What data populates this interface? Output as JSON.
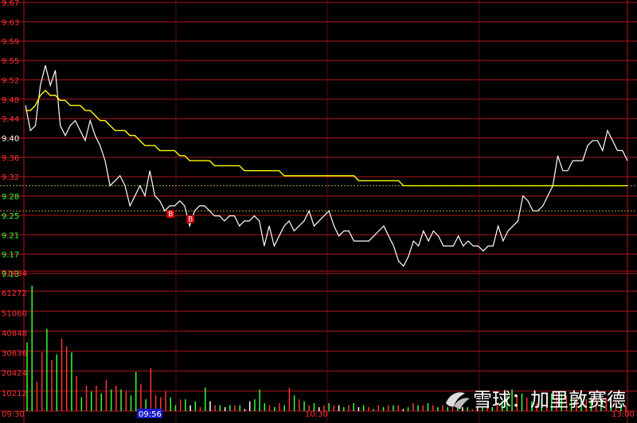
{
  "chart_data": {
    "type": "line",
    "price_axis": {
      "ticks": [
        "9.67",
        "9.63",
        "9.59",
        "9.55",
        "9.52",
        "9.48",
        "9.44",
        "9.40",
        "9.36",
        "9.32",
        "9.28",
        "9.25",
        "9.21",
        "9.17",
        "9.13"
      ],
      "ylim": [
        9.13,
        9.67
      ],
      "reference_price": 9.3,
      "reference_price_alt": 9.25
    },
    "volume_axis": {
      "ticks": [
        "71484",
        "61272",
        "51060",
        "40848",
        "30636",
        "20424",
        "10212"
      ],
      "ylim": [
        0,
        71484
      ]
    },
    "time_axis": {
      "labels": [
        "09:30",
        "09:56",
        "10:30",
        "13:00"
      ],
      "highlighted": "09:56"
    },
    "series": [
      {
        "role": "price",
        "color": "#ffffff",
        "values": [
          9.46,
          9.41,
          9.42,
          9.5,
          9.54,
          9.5,
          9.53,
          9.42,
          9.4,
          9.42,
          9.43,
          9.41,
          9.39,
          9.43,
          9.4,
          9.38,
          9.35,
          9.3,
          9.31,
          9.32,
          9.3,
          9.26,
          9.28,
          9.3,
          9.28,
          9.33,
          9.28,
          9.27,
          9.25,
          9.26,
          9.26,
          9.27,
          9.26,
          9.22,
          9.25,
          9.26,
          9.26,
          9.25,
          9.24,
          9.24,
          9.23,
          9.24,
          9.24,
          9.22,
          9.23,
          9.23,
          9.24,
          9.23,
          9.18,
          9.22,
          9.18,
          9.2,
          9.22,
          9.23,
          9.21,
          9.22,
          9.23,
          9.25,
          9.22,
          9.23,
          9.24,
          9.25,
          9.22,
          9.2,
          9.21,
          9.21,
          9.19,
          9.19,
          9.19,
          9.19,
          9.2,
          9.21,
          9.22,
          9.2,
          9.18,
          9.15,
          9.14,
          9.16,
          9.19,
          9.18,
          9.21,
          9.19,
          9.21,
          9.2,
          9.18,
          9.18,
          9.18,
          9.2,
          9.18,
          9.19,
          9.18,
          9.18,
          9.17,
          9.18,
          9.18,
          9.22,
          9.19,
          9.21,
          9.22,
          9.23,
          9.28,
          9.27,
          9.25,
          9.25,
          9.26,
          9.28,
          9.3,
          9.36,
          9.33,
          9.33,
          9.35,
          9.35,
          9.35,
          9.38,
          9.39,
          9.39,
          9.37,
          9.41,
          9.39,
          9.37,
          9.37,
          9.35
        ]
      },
      {
        "role": "average_price",
        "color": "#ffff00",
        "values": [
          9.45,
          9.45,
          9.46,
          9.48,
          9.49,
          9.48,
          9.48,
          9.47,
          9.47,
          9.46,
          9.46,
          9.46,
          9.45,
          9.45,
          9.44,
          9.43,
          9.43,
          9.42,
          9.41,
          9.41,
          9.41,
          9.4,
          9.4,
          9.39,
          9.38,
          9.38,
          9.38,
          9.37,
          9.37,
          9.37,
          9.37,
          9.36,
          9.36,
          9.35,
          9.35,
          9.35,
          9.35,
          9.35,
          9.34,
          9.34,
          9.34,
          9.34,
          9.34,
          9.34,
          9.33,
          9.33,
          9.33,
          9.33,
          9.33,
          9.33,
          9.33,
          9.33,
          9.32,
          9.32,
          9.32,
          9.32,
          9.32,
          9.32,
          9.32,
          9.32,
          9.32,
          9.32,
          9.32,
          9.32,
          9.32,
          9.32,
          9.32,
          9.31,
          9.31,
          9.31,
          9.31,
          9.31,
          9.31,
          9.31,
          9.31,
          9.31,
          9.3,
          9.3,
          9.3,
          9.3,
          9.3,
          9.3,
          9.3,
          9.3,
          9.3,
          9.3,
          9.3,
          9.3,
          9.3,
          9.3,
          9.3,
          9.3,
          9.3,
          9.3,
          9.3,
          9.3,
          9.3,
          9.3,
          9.3,
          9.3,
          9.3,
          9.3,
          9.3,
          9.3,
          9.3,
          9.3,
          9.3,
          9.3,
          9.3,
          9.3,
          9.3,
          9.3,
          9.3,
          9.3,
          9.3,
          9.3,
          9.3,
          9.3,
          9.3,
          9.3,
          9.3,
          9.3
        ]
      }
    ],
    "markers": [
      {
        "label": "B",
        "index": 29,
        "price": 9.25
      },
      {
        "label": "B",
        "index": 33,
        "price": 9.24
      }
    ],
    "volume": {
      "values": [
        35000,
        64000,
        15000,
        30000,
        42000,
        26000,
        29000,
        37000,
        33000,
        30000,
        18000,
        7000,
        13000,
        10000,
        13000,
        9000,
        16000,
        11000,
        13000,
        11000,
        10000,
        8000,
        20000,
        14000,
        6000,
        22000,
        8000,
        7000,
        10000,
        7000,
        3000,
        6000,
        6000,
        3000,
        5000,
        2000,
        12000,
        5000,
        3000,
        3000,
        2000,
        3000,
        3000,
        3000,
        1000,
        5000,
        6000,
        11000,
        4000,
        3000,
        2000,
        4000,
        3000,
        12000,
        8000,
        6000,
        5000,
        3000,
        4000,
        2000,
        3000,
        4000,
        3000,
        3000,
        2000,
        3000,
        4000,
        2000,
        3000,
        2000,
        1000,
        3000,
        2000,
        3000,
        3000,
        3000,
        1000,
        2000,
        4000,
        3000,
        3000,
        4000,
        3000,
        2000,
        3000,
        2000,
        3000,
        2000,
        2000,
        2000,
        1000,
        2000,
        2000,
        3000,
        2000,
        4000,
        5000,
        8000,
        11000,
        8000,
        9000,
        7000,
        5000,
        4000,
        6000,
        5000,
        9000,
        10000,
        9000,
        8000,
        8000,
        6000,
        7000,
        6000,
        7000,
        7000,
        6000,
        7000,
        4000,
        5000,
        4000,
        3000
      ],
      "colors": [
        "#33ff33",
        "#33ff33",
        "#ff3333",
        "#ff3333",
        "#33ff33",
        "#ff3333",
        "#33ff33",
        "#ff3333",
        "#ff3333",
        "#33ff33",
        "#ff3333",
        "#33ff33",
        "#ff3333",
        "#33ff33",
        "#ff3333",
        "#33ff33",
        "#ff3333",
        "#33ff33",
        "#ff3333",
        "#33ff33",
        "#ff3333",
        "#33ff33",
        "#33ff33",
        "#ff3333",
        "#33ff33",
        "#ff3333",
        "#ff3333",
        "#ff3333",
        "#ff3333",
        "#33ff33",
        "#33ff33",
        "#ff3333",
        "#33ff33",
        "#ffffff",
        "#33ff33",
        "#ff3333",
        "#33ff33",
        "#ffffff",
        "#ff3333",
        "#33ff33",
        "#ffffff",
        "#33ff33",
        "#ff3333",
        "#33ff33",
        "#ffffff",
        "#ffffff",
        "#33ff33",
        "#33ff33",
        "#33ff33",
        "#ff3333",
        "#33ff33",
        "#ff3333",
        "#33ff33",
        "#ff3333",
        "#33ff33",
        "#ff3333",
        "#33ff33",
        "#ff3333",
        "#33ff33",
        "#ffffff",
        "#ff3333",
        "#33ff33",
        "#ff3333",
        "#ffffff",
        "#33ff33",
        "#ff3333",
        "#33ff33",
        "#ffffff",
        "#33ff33",
        "#ff3333",
        "#33ff33",
        "#ff3333",
        "#33ff33",
        "#ff3333",
        "#33ff33",
        "#ff3333",
        "#ffffff",
        "#33ff33",
        "#ff3333",
        "#33ff33",
        "#ff3333",
        "#33ff33",
        "#ff3333",
        "#33ff33",
        "#ff3333",
        "#33ff33",
        "#ff3333",
        "#33ff33",
        "#ffffff",
        "#33ff33",
        "#ff3333",
        "#ffffff",
        "#33ff33",
        "#ff3333",
        "#33ff33",
        "#ff3333",
        "#33ff33",
        "#33ff33",
        "#33ff33",
        "#ff3333",
        "#33ff33",
        "#ff3333",
        "#33ff33",
        "#ff3333",
        "#33ff33",
        "#ff3333",
        "#33ff33",
        "#ff3333",
        "#33ff33",
        "#ff3333",
        "#33ff33",
        "#ff3333",
        "#33ff33",
        "#ff3333",
        "#33ff33",
        "#ff3333",
        "#33ff33",
        "#ff3333",
        "#33ff33",
        "#ff3333",
        "#33ff33",
        "#ff3333"
      ]
    },
    "grid": true,
    "colors": {
      "background": "#000000",
      "grid": "#b0161c",
      "price_up_label": "#ff3333",
      "price_down_label": "#33ff33",
      "price_flat_label": "#ffffff",
      "time_label": "#ff3333",
      "highlight_bg": "#1a1acc",
      "marker_bg": "#cc0000"
    }
  },
  "watermark": {
    "text": "雪球：加里敦赛德",
    "icon": "snowball-logo-icon"
  }
}
